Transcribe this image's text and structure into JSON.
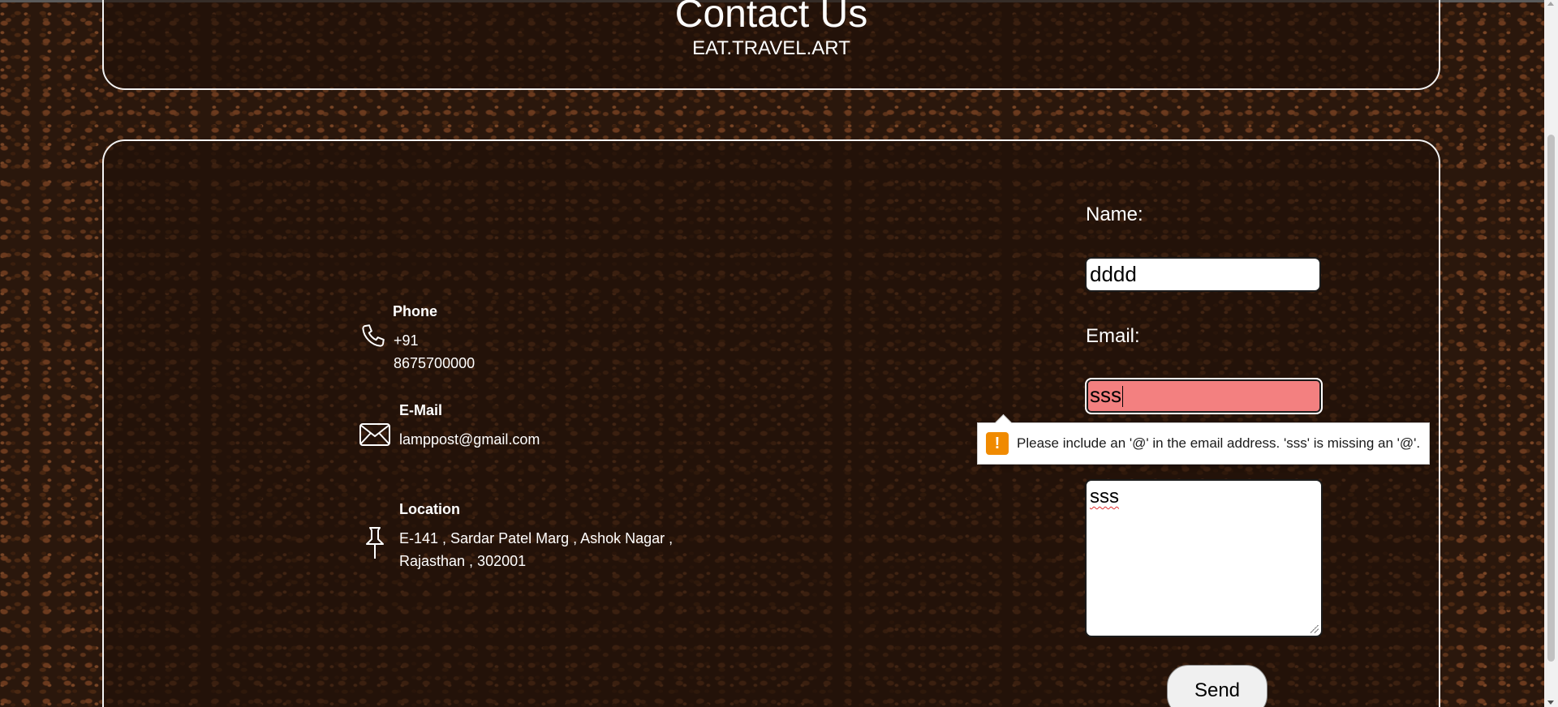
{
  "header": {
    "title": "Contact Us",
    "tagline": "EAT.TRAVEL.ART"
  },
  "contact_info": {
    "phone": {
      "label": "Phone",
      "value": "+91 8675700000",
      "icon": "phone-icon"
    },
    "email": {
      "label": "E-Mail",
      "value": "lamppost@gmail.com",
      "icon": "envelope-icon"
    },
    "location": {
      "label": "Location",
      "line1": "E-141 , Sardar Patel Marg , Ashok Nagar ,",
      "line2": "Rajasthan , 302001",
      "icon": "pushpin-icon"
    }
  },
  "form": {
    "name_label": "Name:",
    "name_value": "dddd",
    "email_label": "Email:",
    "email_value": "sss",
    "message_value": "sss",
    "send_label": "Send"
  },
  "validation": {
    "icon": "warning-icon",
    "badge": "!",
    "message": "Please include an '@' in the email address. 'sss' is missing an '@'."
  },
  "colors": {
    "invalid_field": "#f38080",
    "warning": "#f08a00",
    "panel_border": "#f2f2f2"
  }
}
